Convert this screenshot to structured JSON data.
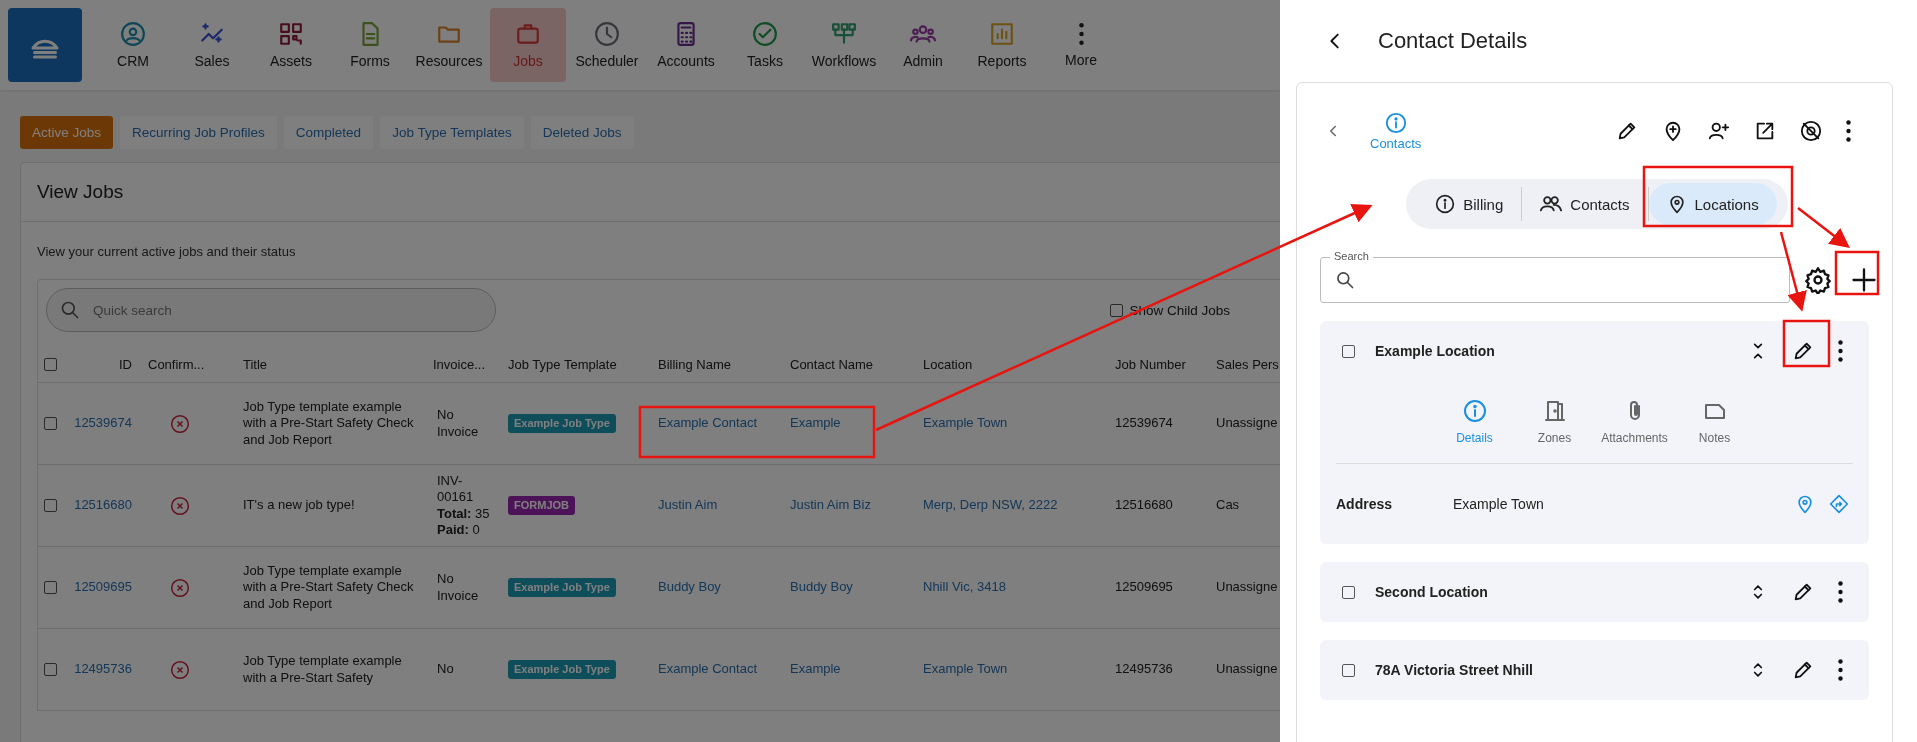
{
  "nav": {
    "items": [
      {
        "label": "CRM",
        "selected": false
      },
      {
        "label": "Sales",
        "selected": false
      },
      {
        "label": "Assets",
        "selected": false
      },
      {
        "label": "Forms",
        "selected": false
      },
      {
        "label": "Resources",
        "selected": false
      },
      {
        "label": "Jobs",
        "selected": true
      },
      {
        "label": "Scheduler",
        "selected": false
      },
      {
        "label": "Accounts",
        "selected": false
      },
      {
        "label": "Tasks",
        "selected": false
      },
      {
        "label": "Workflows",
        "selected": false
      },
      {
        "label": "Admin",
        "selected": false
      },
      {
        "label": "Reports",
        "selected": false
      },
      {
        "label": "More",
        "selected": false
      }
    ]
  },
  "job_tabs": [
    {
      "label": "Active Jobs",
      "selected": true
    },
    {
      "label": "Recurring Job Profiles",
      "selected": false
    },
    {
      "label": "Completed",
      "selected": false
    },
    {
      "label": "Job Type Templates",
      "selected": false
    },
    {
      "label": "Deleted Jobs",
      "selected": false
    }
  ],
  "view_jobs": {
    "title": "View Jobs",
    "description": "View your current active jobs and their status",
    "search": {
      "placeholder": "Quick search"
    },
    "show_child_jobs": {
      "label": "Show Child Jobs",
      "checked": false
    },
    "table": {
      "select_all": {
        "checked": false
      },
      "columns": [
        "ID",
        "Confirm...",
        "Title",
        "Invoice...",
        "Job Type Template",
        "Billing Name",
        "Contact Name",
        "Location",
        "Job Number",
        "Sales Pers"
      ],
      "rows": [
        {
          "checked": false,
          "id": "12539674",
          "confirmed": false,
          "title": "Job Type template example with a Pre-Start Safety Check and Job Report",
          "invoice": [
            "No Invoice"
          ],
          "template": {
            "label": "Example Job Type",
            "kind": "standard"
          },
          "billing_name": "Example Contact",
          "contact_name": "Example",
          "location": "Example Town",
          "job_number": "12539674",
          "sales_person": "Unassigne"
        },
        {
          "checked": false,
          "id": "12516680",
          "confirmed": false,
          "title": "IT's a new job type!",
          "invoice": [
            "INV-00161",
            "**Total:** 35",
            "**Paid:** 0"
          ],
          "template": {
            "label": "FORMJOB",
            "kind": "form"
          },
          "billing_name": "Justin Aim",
          "contact_name": "Justin Aim Biz",
          "location": "Merp, Derp NSW, 2222",
          "job_number": "12516680",
          "sales_person": "Cas"
        },
        {
          "checked": false,
          "id": "12509695",
          "confirmed": false,
          "title": "Job Type template example with a Pre-Start Safety Check and Job Report",
          "invoice": [
            "No Invoice"
          ],
          "template": {
            "label": "Example Job Type",
            "kind": "standard"
          },
          "billing_name": "Buddy Boy",
          "contact_name": "Buddy Boy",
          "location": "Nhill Vic, 3418",
          "job_number": "12509695",
          "sales_person": "Unassigne"
        },
        {
          "checked": false,
          "id": "12495736",
          "confirmed": false,
          "title": "Job Type template example with a Pre-Start Safety",
          "invoice": [
            "No"
          ],
          "template": {
            "label": "Example Job Type",
            "kind": "standard"
          },
          "billing_name": "Example Contact",
          "contact_name": "Example",
          "location": "Example Town",
          "job_number": "12495736",
          "sales_person": "Unassigne"
        }
      ]
    }
  },
  "contact_details": {
    "title": "Contact Details",
    "header": {
      "label": "Contacts"
    },
    "tabs": [
      {
        "label": "Billing",
        "selected": false
      },
      {
        "label": "Contacts",
        "selected": false
      },
      {
        "label": "Locations",
        "selected": true
      }
    ],
    "search": {
      "label": "Search"
    },
    "locations": [
      {
        "name": "Example Location",
        "checked": false,
        "expanded": true,
        "detail_tabs": [
          {
            "label": "Details",
            "selected": true
          },
          {
            "label": "Zones",
            "selected": false
          },
          {
            "label": "Attachments",
            "selected": false
          },
          {
            "label": "Notes",
            "selected": false
          }
        ],
        "address_label": "Address",
        "address": "Example Town"
      },
      {
        "name": "Second Location",
        "checked": false,
        "expanded": false
      },
      {
        "name": "78A Victoria Street Nhill",
        "checked": false,
        "expanded": false
      }
    ]
  }
}
